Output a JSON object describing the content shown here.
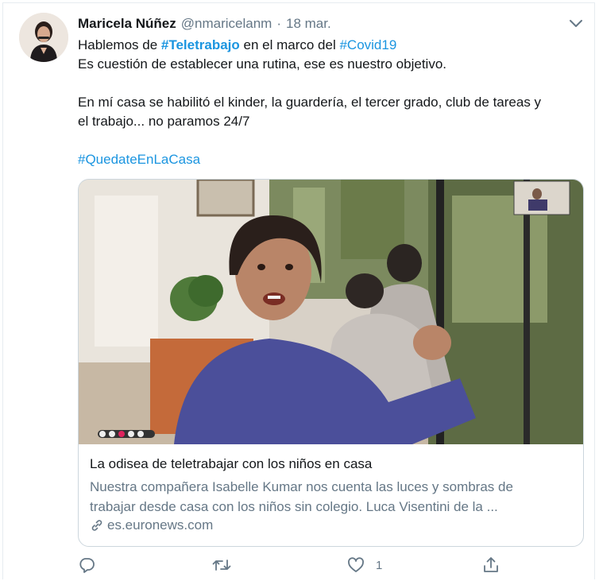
{
  "tweet": {
    "author_name": "Maricela Núñez",
    "handle": "@nmaricelanm",
    "separator": "·",
    "date": "18 mar.",
    "line1_pre": "Hablemos de ",
    "hashtag1": "#Teletrabajo",
    "line1_mid": " en el marco del ",
    "hashtag2": "#Covid19",
    "line2": "Es cuestión de establecer una rutina, ese es nuestro objetivo.",
    "line3": "En mí casa se habilitó el kinder, la guardería, el tercer grado, club de tareas y",
    "line4": "el trabajo... no paramos 24/7",
    "hashtag3": "#QuedateEnLaCasa"
  },
  "card": {
    "title": "La odisea de teletrabajar con los niños en casa",
    "description_line1": "Nuestra compañera Isabelle Kumar nos cuenta las luces y sombras de",
    "description_line2": "trabajar desde casa con los niños sin colegio. Luca Visentini de la ...",
    "domain": "es.euronews.com"
  },
  "actions": {
    "reply_icon": "reply-icon",
    "retweet_icon": "retweet-icon",
    "like_icon": "heart-icon",
    "like_count": "1",
    "share_icon": "share-icon"
  },
  "colors": {
    "link": "#1b95e0",
    "secondary_text": "#657786",
    "border": "#ccd6dd"
  }
}
